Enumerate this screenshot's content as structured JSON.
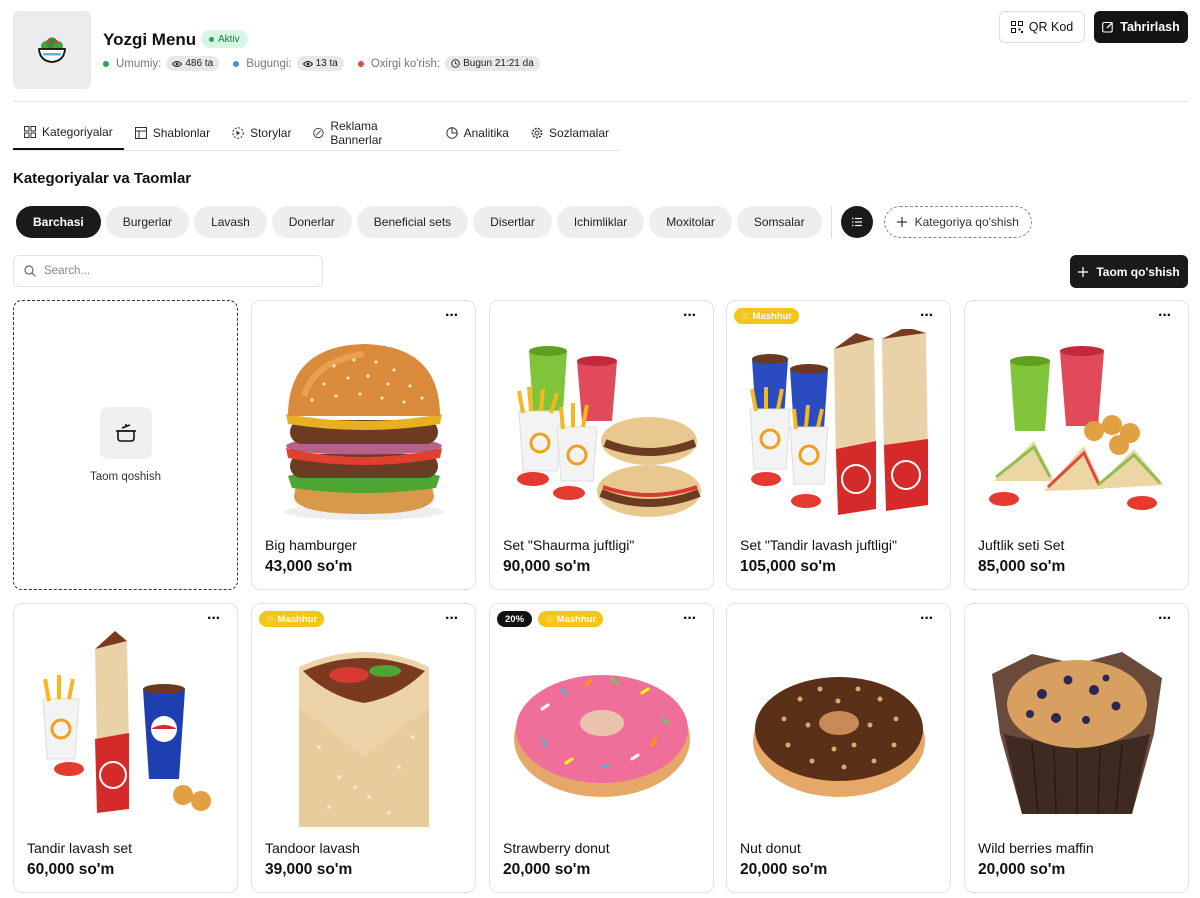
{
  "header": {
    "title": "Yozgi Menu",
    "status": "Aktiv",
    "stats": [
      {
        "label": "Umumiy:",
        "value": "486 ta",
        "color": "#22a652",
        "icon": "eye-icon"
      },
      {
        "label": "Bugungi:",
        "value": "13 ta",
        "color": "#4a90d9",
        "icon": "eye-icon"
      },
      {
        "label": "Oxirgi ko'rish:",
        "value": "Bugun 21:21 da",
        "color": "#e04848",
        "icon": "clock-icon"
      }
    ],
    "qr_label": "QR Kod",
    "edit_label": "Tahrirlash"
  },
  "tabs": [
    {
      "label": "Kategoriyalar",
      "icon": "grid-icon",
      "active": true
    },
    {
      "label": "Shablonlar",
      "icon": "template-icon"
    },
    {
      "label": "Storylar",
      "icon": "story-icon"
    },
    {
      "label": "Reklama Bannerlar",
      "icon": "banner-icon"
    },
    {
      "label": "Analitika",
      "icon": "pie-chart-icon"
    },
    {
      "label": "Sozlamalar",
      "icon": "gear-icon"
    }
  ],
  "section_title": "Kategoriyalar va Taomlar",
  "categories": [
    "Barchasi",
    "Burgerlar",
    "Lavash",
    "Donerlar",
    "Beneficial sets",
    "Disertlar",
    "Ichimliklar",
    "Moxitolar",
    "Somsalar"
  ],
  "add_category_label": "Kategoriya qo'shish",
  "search": {
    "placeholder": "Search..."
  },
  "add_food_label": "Taom qo'shish",
  "add_card_label": "Taom qoshish",
  "badge_popular": "Mashhur",
  "items": [
    {
      "name": "Big hamburger",
      "price": "43,000 so'm",
      "image": "burger",
      "popular": false,
      "discount": ""
    },
    {
      "name": "Set \"Shaurma juftligi\"",
      "price": "90,000 so'm",
      "image": "shaurma-set",
      "popular": false,
      "discount": ""
    },
    {
      "name": "Set \"Tandir lavash juftligi\"",
      "price": "105,000 so'm",
      "image": "lavash-set",
      "popular": true,
      "discount": ""
    },
    {
      "name": "Juftlik seti Set",
      "price": "85,000 so'm",
      "image": "sandwich-set",
      "popular": false,
      "discount": ""
    },
    {
      "name": "Tandir lavash set",
      "price": "60,000 so'm",
      "image": "tandir-set",
      "popular": false,
      "discount": ""
    },
    {
      "name": "Tandoor lavash",
      "price": "39,000 so'm",
      "image": "lavash",
      "popular": true,
      "discount": ""
    },
    {
      "name": "Strawberry donut",
      "price": "20,000 so'm",
      "image": "pink-donut",
      "popular": true,
      "discount": "20%"
    },
    {
      "name": "Nut donut",
      "price": "20,000 so'm",
      "image": "nut-donut",
      "popular": false,
      "discount": ""
    },
    {
      "name": "Wild berries maffin",
      "price": "20,000 so'm",
      "image": "muffin",
      "popular": false,
      "discount": ""
    }
  ]
}
